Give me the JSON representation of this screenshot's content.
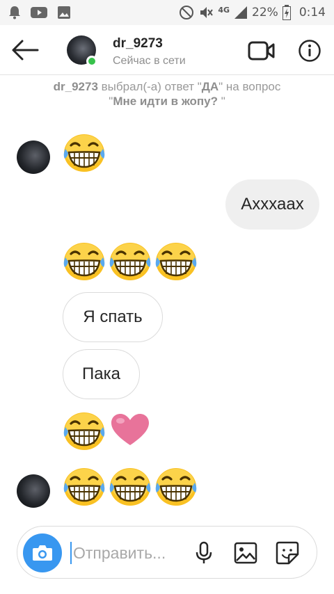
{
  "statusbar": {
    "network": "4G",
    "battery": "22%",
    "time": "0:14",
    "icons": [
      "notification-bell-icon",
      "youtube-icon",
      "gallery-icon",
      "do-not-disturb-icon",
      "mute-icon",
      "signal-icon",
      "battery-icon"
    ]
  },
  "header": {
    "username": "dr_9273",
    "status": "Сейчас в сети",
    "icons": [
      "back-arrow-icon",
      "video-call-icon",
      "info-icon"
    ]
  },
  "system_message": {
    "user": "dr_9273",
    "text1": " выбрал(-а) ответ \"",
    "answer": "ДА",
    "text2": "\" на вопрос",
    "question_open": "\"",
    "question": "Мне идти в жопу?",
    "question_close": " \""
  },
  "messages": [
    {
      "from": "other",
      "kind": "emoji",
      "content": [
        "laughing-emoji"
      ]
    },
    {
      "from": "me",
      "kind": "text",
      "content": "Ахххаах"
    },
    {
      "from": "other",
      "kind": "emoji",
      "content": [
        "laughing-emoji",
        "laughing-emoji",
        "laughing-emoji"
      ]
    },
    {
      "from": "other",
      "kind": "text",
      "content": "Я спать"
    },
    {
      "from": "other",
      "kind": "text",
      "content": "Пака"
    },
    {
      "from": "other",
      "kind": "emoji",
      "content": [
        "laughing-emoji",
        "pink-heart-emoji"
      ]
    },
    {
      "from": "other",
      "kind": "emoji",
      "content": [
        "laughing-emoji",
        "laughing-emoji",
        "laughing-emoji"
      ]
    }
  ],
  "composer": {
    "placeholder": "Отправить...",
    "value": "",
    "icons": [
      "camera-icon",
      "microphone-icon",
      "gallery-icon",
      "sticker-icon"
    ]
  },
  "colors": {
    "accent": "#3897f0",
    "online": "#37c24b",
    "emoji_yellow": "#f9c123",
    "heart_pink": "#e8739a"
  }
}
